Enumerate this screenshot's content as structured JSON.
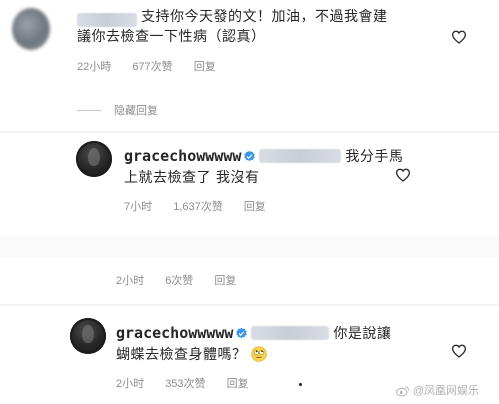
{
  "comments": [
    {
      "id": "top",
      "line1": "支持你今天發的文！加油，不過我會建",
      "line2": "議你去檢查一下性病（認真）",
      "meta": {
        "time": "22小時",
        "likes": "677次赞",
        "reply": "回复"
      }
    },
    {
      "id": "reply-1",
      "username": "gracechowwwww",
      "line1": "我分手馬",
      "line2": "上就去檢查了 我沒有",
      "meta": {
        "time": "7小时",
        "likes": "1,637次赞",
        "reply": "回复"
      }
    },
    {
      "id": "reply-2",
      "meta": {
        "time": "2小时",
        "likes": "6次赞",
        "reply": "回复"
      }
    },
    {
      "id": "reply-3",
      "username": "gracechowwwww",
      "line1": "你是說讓",
      "line2": "蝴蝶去檢查身體嗎？",
      "emoji": "rolling-eyes-emoji",
      "meta": {
        "time": "2小时",
        "likes": "353次赞",
        "reply": "回复"
      }
    }
  ],
  "hidden_replies_label": "隐藏回复",
  "watermark": "@凤凰网娱乐",
  "colors": {
    "verified": "#3897f0",
    "meta": "#8e8e8e",
    "text": "#262626"
  },
  "icons": {
    "like": "heart-outline-icon",
    "verified": "verified-badge-icon"
  }
}
